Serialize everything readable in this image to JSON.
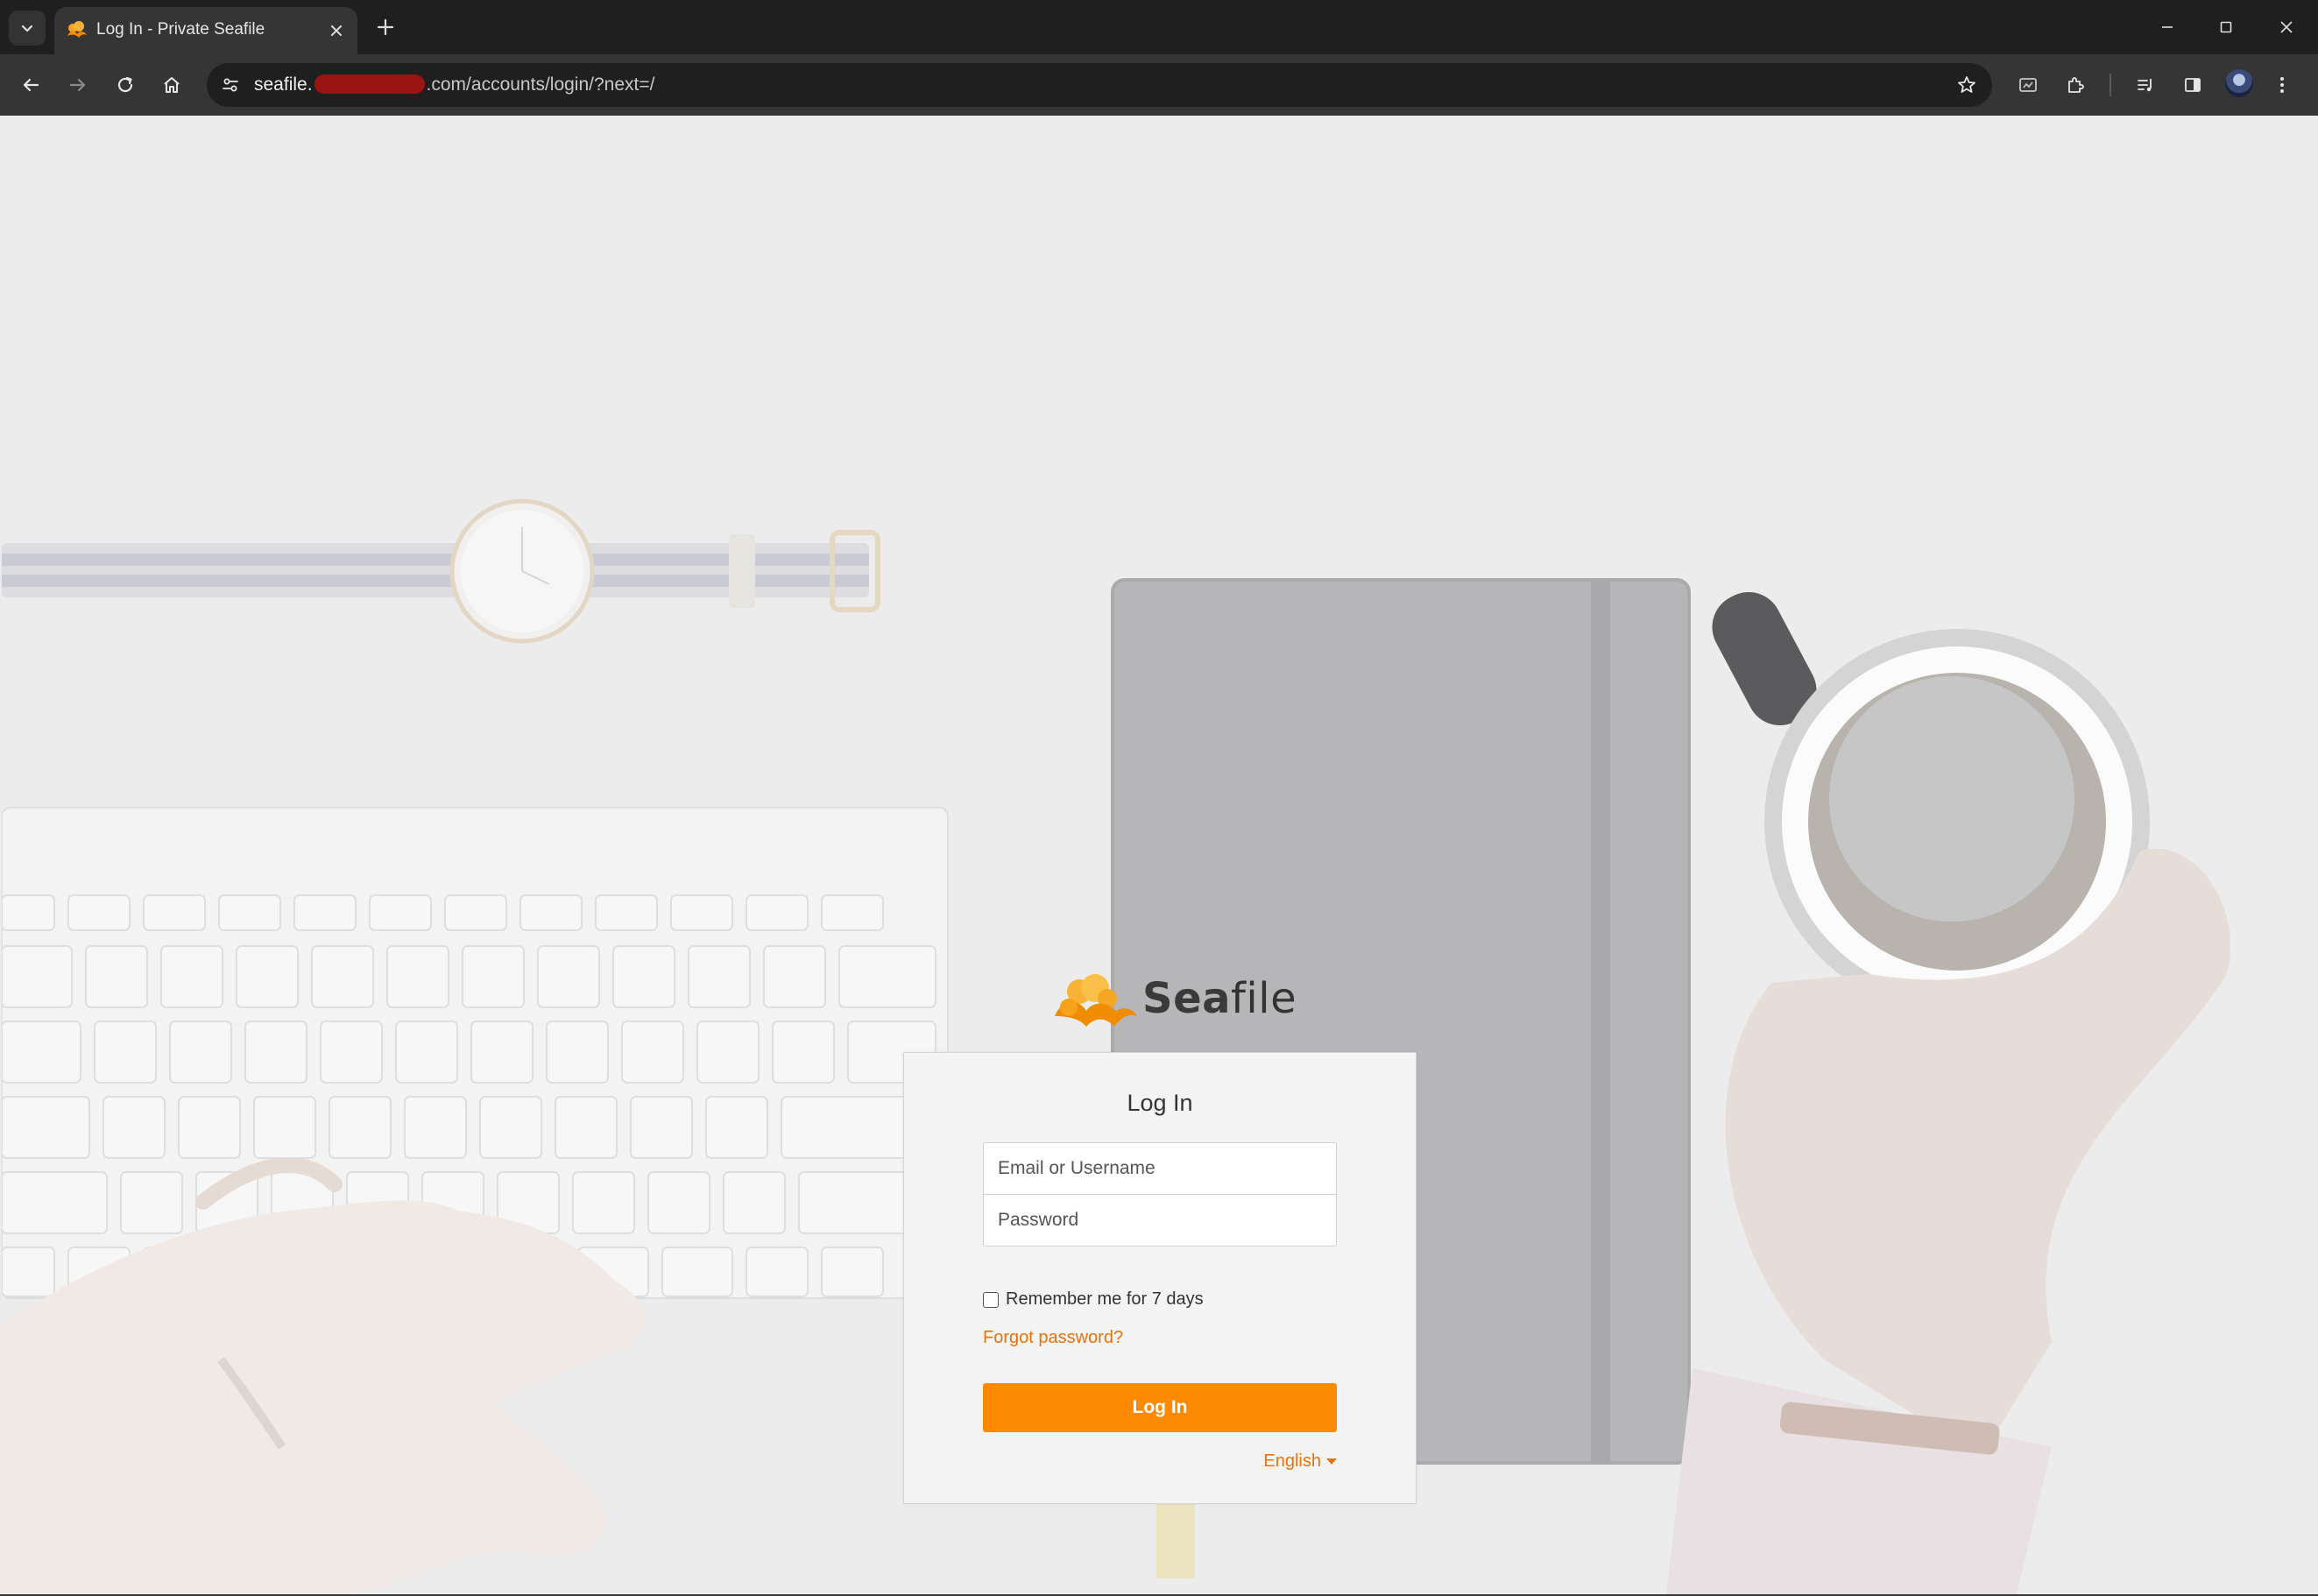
{
  "browser": {
    "tab_title": "Log In - Private Seafile",
    "url_host": "seafile.",
    "url_rest": ".com/accounts/login/?next=/"
  },
  "brand": {
    "logo_text_bold": "Sea",
    "logo_text_light": "file",
    "accent": "#fd8a00"
  },
  "login": {
    "heading": "Log In",
    "username_placeholder": "Email or Username",
    "password_placeholder": "Password",
    "remember_label": "Remember me for 7 days",
    "remember_checked": false,
    "forgot_link": "Forgot password?",
    "submit_label": "Log In",
    "language": "English"
  }
}
